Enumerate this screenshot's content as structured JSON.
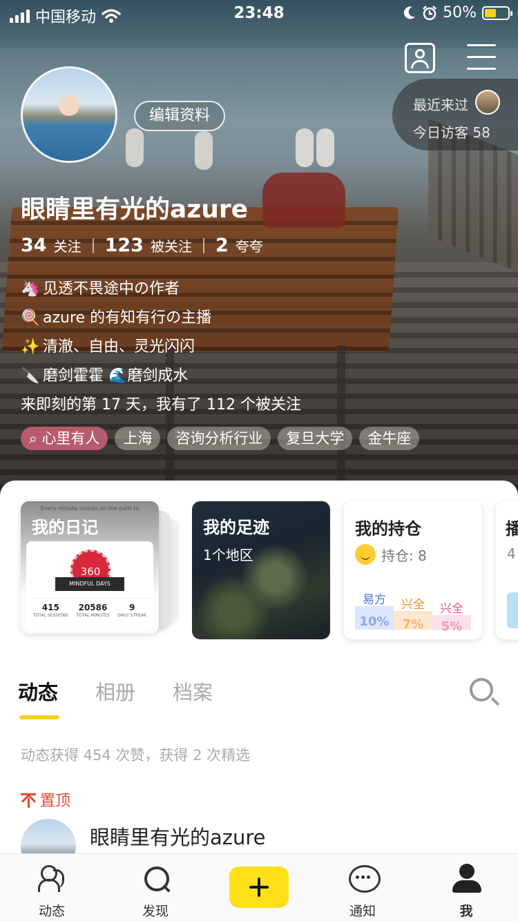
{
  "status_bar": {
    "carrier": "中国移动",
    "time": "23:48",
    "battery": "50%"
  },
  "profile": {
    "edit_label": "编辑资料",
    "recent_visitors_label": "最近来过",
    "today_visitors_label": "今日访客 58",
    "username": "眼睛里有光的azure",
    "stats": [
      {
        "num": "34",
        "label": "关注"
      },
      {
        "num": "123",
        "label": "被关注"
      },
      {
        "num": "2",
        "label": "夸夸"
      }
    ],
    "bio": [
      {
        "emoji": "🦄",
        "text": "见透不畏途中の作者"
      },
      {
        "emoji": "🍭",
        "text": "azure 的有知有行の主播"
      },
      {
        "emoji": "✨",
        "text": "清澈、自由、灵光闪闪"
      },
      {
        "emoji": "🔪",
        "text": "磨剑霍霍 🌊磨剑成水"
      },
      {
        "emoji": "",
        "text": "来即刻的第 17 天，我有了 112 个被关注"
      }
    ],
    "tags": [
      "心里有人",
      "上海",
      "咨询分析行业",
      "复旦大学",
      "金牛座"
    ]
  },
  "cards": {
    "diary": {
      "title": "我的日记",
      "tiny_text": "Every minute counts on the path to",
      "badge_value": "360",
      "badge_label": "MINDFUL DAYS",
      "stats": [
        {
          "value": "415",
          "label": "TOTAL SESSIONS"
        },
        {
          "value": "20586",
          "label": "TOTAL MINUTES"
        },
        {
          "value": "9",
          "label": "DAILY STREAK"
        }
      ]
    },
    "footprint": {
      "title": "我的足迹",
      "subtitle": "1个地区"
    },
    "holding": {
      "title": "我的持仓",
      "subtitle": "持仓: 8",
      "bars": [
        {
          "label": "易方",
          "value": "10%",
          "label_color": "#4a74d8",
          "bg": "#dde6fb",
          "text_color": "#8fa6e4",
          "level": 0.6
        },
        {
          "label": "兴全",
          "value": "7%",
          "label_color": "#f08a1f",
          "bg": "#fde7cf",
          "text_color": "#f5b26b",
          "level": 0.48
        },
        {
          "label": "兴全",
          "value": "5%",
          "label_color": "#e85a8a",
          "bg": "#fde0ea",
          "text_color": "#f19ab7",
          "level": 0.38
        }
      ]
    },
    "partial": {
      "title": "播",
      "sub": "4"
    }
  },
  "tabs": [
    "动态",
    "相册",
    "档案"
  ],
  "likes_summary": "动态获得 454 次赞，获得 2 次精选",
  "pinned_label": "置顶",
  "post": {
    "author": "眼睛里有光的azure"
  },
  "bottom_nav": [
    "动态",
    "发现",
    "通知",
    "我"
  ],
  "colors": {
    "accent": "#f7d21f",
    "pinned": "#e34a2f",
    "tag_highlight": "#ce6078"
  }
}
